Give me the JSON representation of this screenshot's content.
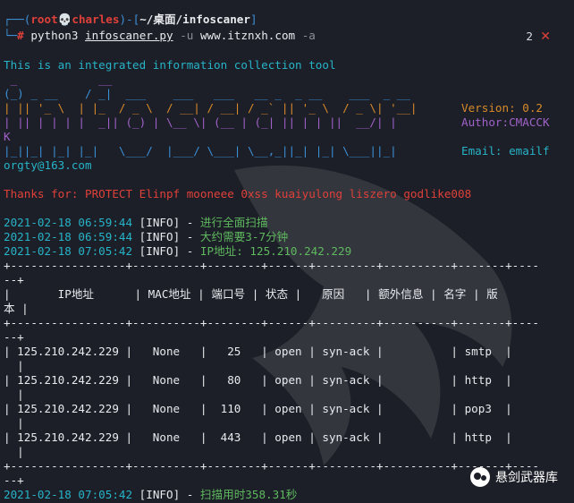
{
  "prompt": {
    "line1_prefix": "┌──(",
    "user": "root",
    "skull": "💀",
    "host": "charles",
    "mid": ")-[",
    "path": "~/桌面/infoscaner",
    "end": "]",
    "line2_prefix": "└─",
    "hash": "#",
    "cmd": "python3",
    "script": "infoscaner.py",
    "flag_u": "-u",
    "url": "www.itznxh.com",
    "flag_a": "-a"
  },
  "window": {
    "count": "2",
    "close": "✕"
  },
  "intro": "This is an integrated information collection tool",
  "banner": {
    "row1": " _            __                                                   ",
    "row2": "(_) _ __    / _|  ___    ___   ___   __ _  _ __    ___  _ __       ",
    "row3": "| || '_ \\  | |_  / _ \\  / __| / __| / _` || '_ \\  / _ \\| '__|",
    "row4": "| || | | | |  _|| (_) | \\__ \\| (__ | (_| || | | ||  __/| |   ",
    "row5": "K",
    "row6": "|_||_| |_| |_|   \\___/  |___/ \\___| \\__,_||_| |_| \\___||_|   ",
    "version": "Version: 0.2",
    "author": "Author:CMACCK",
    "email": "Email: emailf",
    "email2": "orgty@163.com"
  },
  "thanks": "Thanks for: PROTECT Elinpf mooneee 0xss kuaiyulong liszero godlike008",
  "logs": [
    {
      "time": "2021-02-18 06:59:44",
      "level": "[INFO]",
      "sep": " - ",
      "msg": "进行全面扫描"
    },
    {
      "time": "2021-02-18 06:59:44",
      "level": "[INFO]",
      "sep": " - ",
      "msg": "大约需要3-7分钟"
    },
    {
      "time": "2021-02-18 07:05:42",
      "level": "[INFO]",
      "sep": " - ",
      "msg": "IP地址: 125.210.242.229"
    }
  ],
  "table": {
    "border_top": "+-----------------+----------+--------+------+---------+----------+-------+----",
    "border_wrap": "--+",
    "header": "|       IP地址      | MAC地址 | 端口号 | 状态 |   原因   | 额外信息 | 名字 | 版",
    "header_wrap": "本 |",
    "rows": [
      {
        "line": "| 125.210.242.229 |   None   |   25   | open | syn-ack |          | smtp  |",
        "wrap": "  |"
      },
      {
        "line": "| 125.210.242.229 |   None   |   80   | open | syn-ack |          | http  |",
        "wrap": "  |"
      },
      {
        "line": "| 125.210.242.229 |   None   |  110   | open | syn-ack |          | pop3  |",
        "wrap": "  |"
      },
      {
        "line": "| 125.210.242.229 |   None   |  443   | open | syn-ack |          | http  |",
        "wrap": "  |"
      }
    ]
  },
  "final_log": {
    "time": "2021-02-18 07:05:42",
    "level": "[INFO]",
    "sep": " - ",
    "msg": "扫描用时358.31秒"
  },
  "watermark": "悬剑武器库",
  "colors": {
    "background": "#1c1f27",
    "prompt_blue": "#3d8fd6",
    "prompt_red": "#e0403a",
    "banner_orange": "#d78a2a",
    "banner_purple": "#a061c9",
    "info_cyan": "#27b3c8"
  }
}
